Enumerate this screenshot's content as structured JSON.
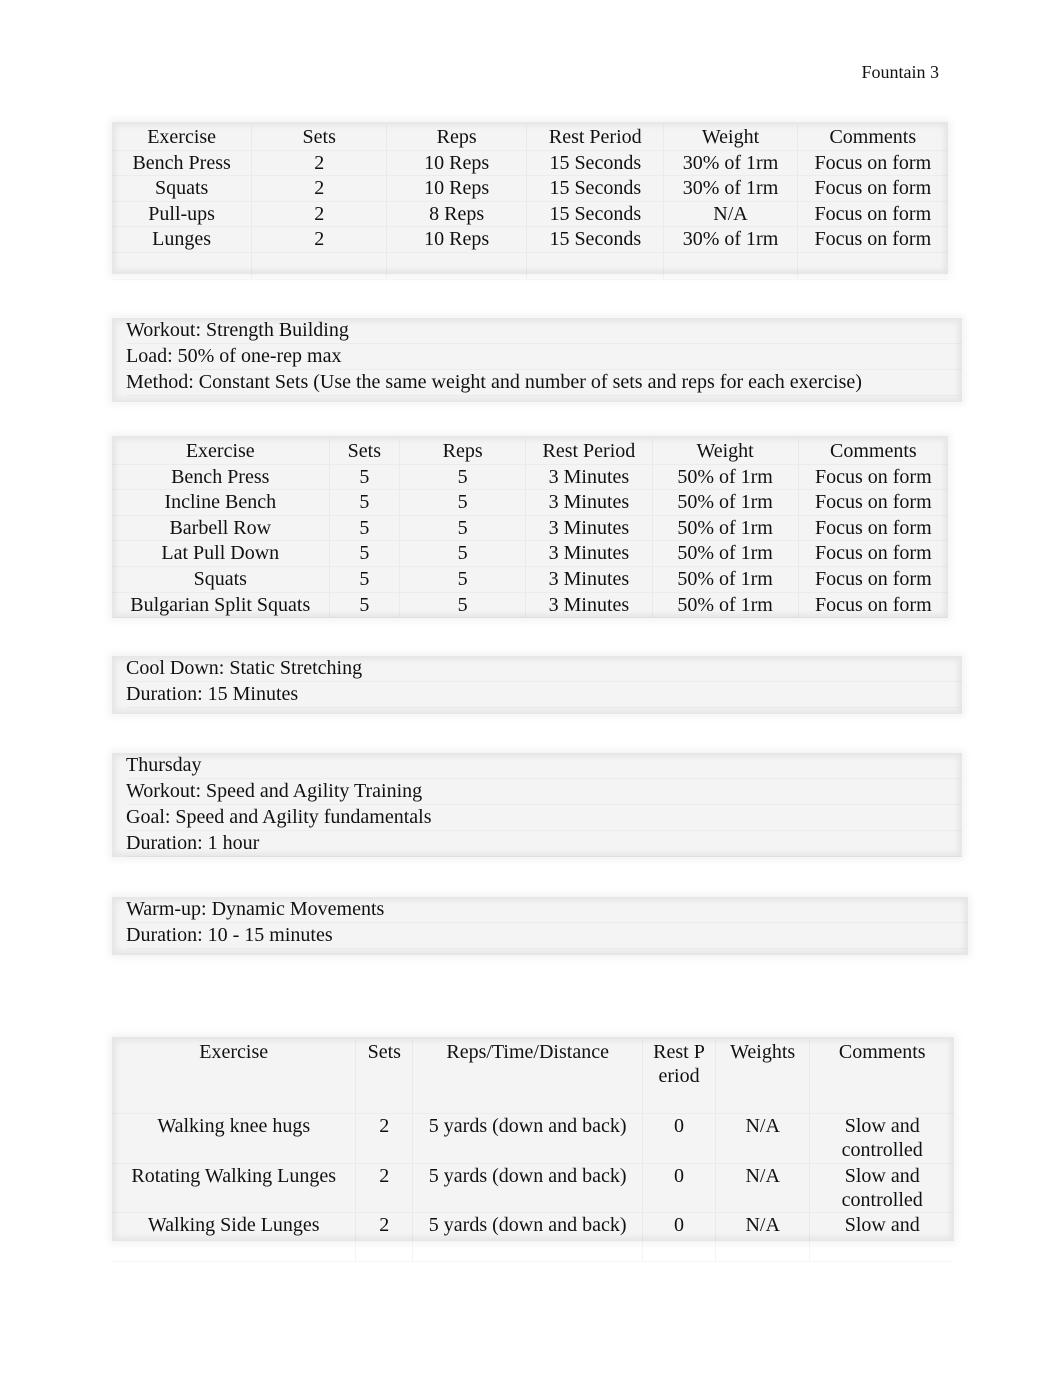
{
  "header": {
    "running_head": "Fountain 3"
  },
  "table1": {
    "columns": [
      "Exercise",
      "Sets",
      "Reps",
      "Rest Period",
      "Weight",
      "Comments"
    ],
    "rows": [
      [
        "Bench Press",
        "2",
        "10 Reps",
        "15 Seconds",
        "30% of 1rm",
        "Focus on form"
      ],
      [
        "Squats",
        "2",
        "10 Reps",
        "15 Seconds",
        "30% of 1rm",
        "Focus on form"
      ],
      [
        "Pull-ups",
        "2",
        "8 Reps",
        "15 Seconds",
        "N/A",
        "Focus on form"
      ],
      [
        "Lunges",
        "2",
        "10 Reps",
        "15 Seconds",
        "30% of 1rm",
        "Focus on form"
      ]
    ]
  },
  "strength_block": {
    "lines": [
      "Workout: Strength Building",
      "Load: 50% of one-rep max",
      "Method: Constant Sets (Use the same weight and number of sets and reps for each exercise)"
    ]
  },
  "table2": {
    "columns": [
      "Exercise",
      "Sets",
      "Reps",
      "Rest Period",
      "Weight",
      "Comments"
    ],
    "rows": [
      [
        "Bench Press",
        "5",
        "5",
        "3 Minutes",
        "50% of 1rm",
        "Focus on form"
      ],
      [
        "Incline Bench",
        "5",
        "5",
        "3 Minutes",
        "50% of 1rm",
        "Focus on form"
      ],
      [
        "Barbell Row",
        "5",
        "5",
        "3 Minutes",
        "50% of 1rm",
        "Focus on form"
      ],
      [
        "Lat Pull Down",
        "5",
        "5",
        "3 Minutes",
        "50% of 1rm",
        "Focus on form"
      ],
      [
        "Squats",
        "5",
        "5",
        "3 Minutes",
        "50% of 1rm",
        "Focus on form"
      ],
      [
        "Bulgarian Split Squats",
        "5",
        "5",
        "3 Minutes",
        "50% of 1rm",
        "Focus on form"
      ]
    ]
  },
  "cooldown_block": {
    "lines": [
      "Cool Down:  Static Stretching",
      "Duration: 15 Minutes"
    ]
  },
  "thursday_block": {
    "lines": [
      "Thursday",
      "Workout: Speed and Agility Training",
      "Goal: Speed and Agility fundamentals",
      "Duration: 1 hour"
    ]
  },
  "warmup_block": {
    "lines": [
      "Warm-up: Dynamic Movements",
      "Duration: 10 - 15 minutes"
    ]
  },
  "table3": {
    "columns": [
      "Exercise",
      "Sets",
      "Reps/Time/Distance",
      "Rest Period",
      "Weights",
      "Comments"
    ],
    "rows": [
      [
        "Walking knee hugs",
        "2",
        "5 yards (down and back)",
        "0",
        "N/A",
        "Slow and controlled"
      ],
      [
        "Rotating Walking Lunges",
        "2",
        "5 yards (down and back)",
        "0",
        "N/A",
        "Slow and controlled"
      ],
      [
        "Walking Side Lunges",
        "2",
        "5 yards (down and back)",
        "0",
        "N/A",
        "Slow and"
      ]
    ]
  }
}
